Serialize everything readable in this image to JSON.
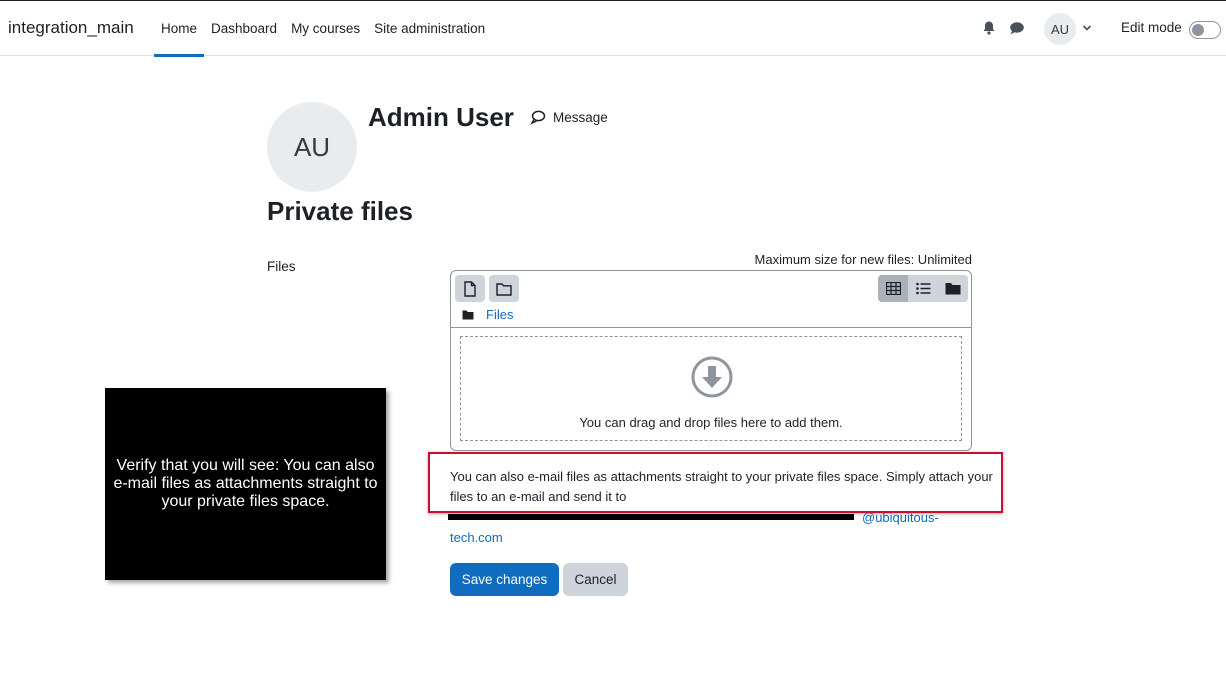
{
  "navbar": {
    "brand": "integration_main",
    "links": [
      {
        "label": "Home",
        "active": true
      },
      {
        "label": "Dashboard",
        "active": false
      },
      {
        "label": "My courses",
        "active": false
      },
      {
        "label": "Site administration",
        "active": false
      }
    ],
    "icons": [
      "bell-icon",
      "chat-icon"
    ],
    "avatar_initials": "AU",
    "edit_mode_label": "Edit mode",
    "edit_mode_on": false
  },
  "profile": {
    "avatar_initials": "AU",
    "name": "Admin User",
    "message_label": "Message"
  },
  "page": {
    "title": "Private files",
    "files_label": "Files",
    "max_size": "Maximum size for new files: Unlimited"
  },
  "filemanager": {
    "path_label": "Files",
    "drop_text": "You can drag and drop files here to add them.",
    "active_view": "grid"
  },
  "email_note": {
    "text": "You can also e-mail files as attachments straight to your private files space. Simply attach your files to an e-mail and send it to",
    "address_part1": "@ubiquitous-",
    "address_part2": "tech.com"
  },
  "buttons": {
    "save": "Save changes",
    "cancel": "Cancel"
  },
  "tooltip": {
    "text": "Verify that you will see: You can also e-mail files as attachments straight to your private files space."
  },
  "colors": {
    "primary": "#0f6cbf",
    "highlight_border": "#c8102e",
    "secondary": "#ced4da"
  }
}
